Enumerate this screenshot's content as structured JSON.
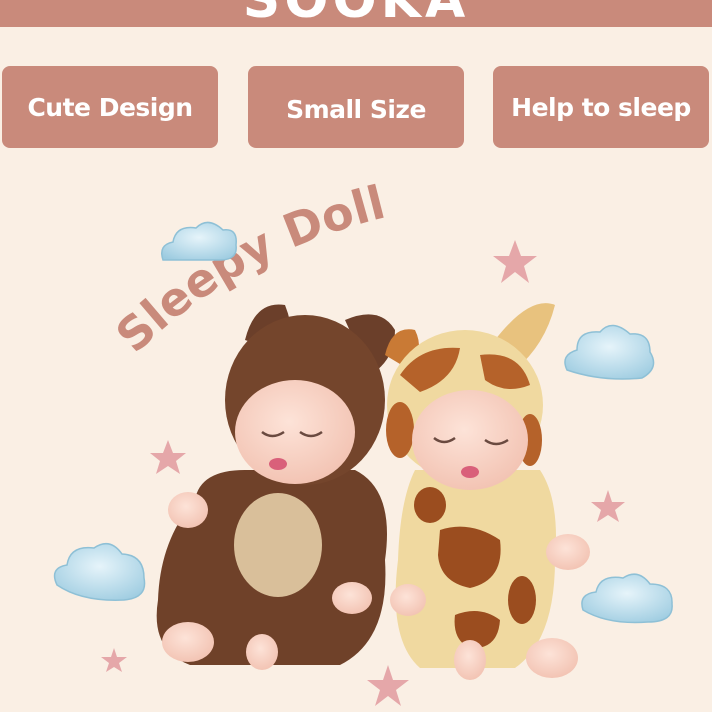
{
  "brand": {
    "name": "SOOKA"
  },
  "features": [
    {
      "label": "Cute Design"
    },
    {
      "label": "Small Size"
    },
    {
      "label": "Help to sleep"
    }
  ],
  "hero": {
    "title": "Sleepy Doll"
  },
  "colors": {
    "background": "#faefe4",
    "accent": "#c98a7b",
    "title_text": "#c98a7b",
    "star": "#e5a7a9",
    "cloud": "#a8d4e4"
  },
  "icons": [
    "cloud-icon",
    "star-icon"
  ]
}
